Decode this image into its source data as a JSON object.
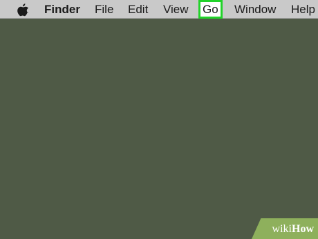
{
  "menubar": {
    "apple_icon": "apple-logo-icon",
    "app_name": "Finder",
    "items": [
      "File",
      "Edit",
      "View",
      "Go",
      "Window",
      "Help"
    ],
    "highlighted_item": "Go",
    "highlight_color": "#22d32a"
  },
  "desktop": {
    "background_color": "#4f5a46"
  },
  "watermark": {
    "wiki": "wiki",
    "how": "How"
  }
}
